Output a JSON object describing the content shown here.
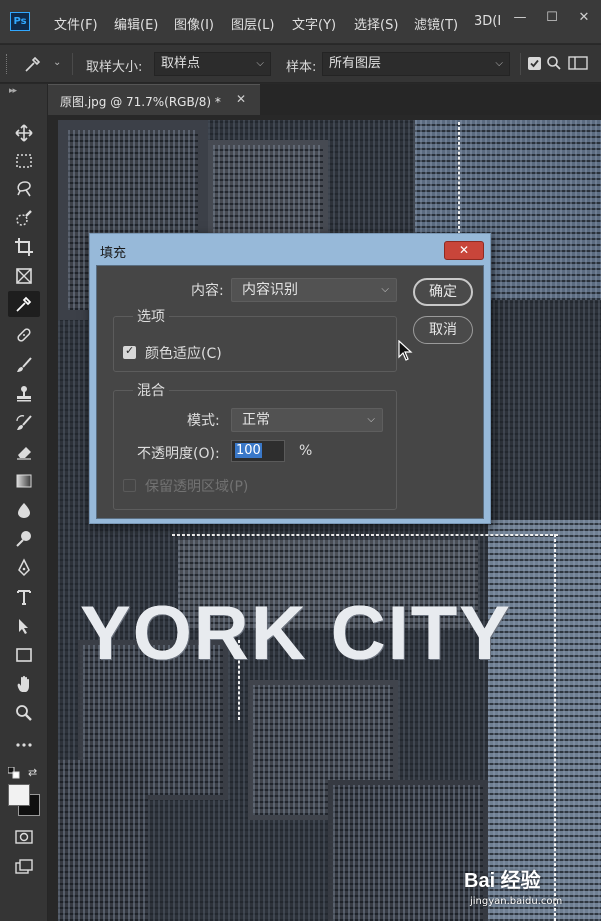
{
  "app": {
    "logo": "Ps"
  },
  "menu": [
    "文件(F)",
    "编辑(E)",
    "图像(I)",
    "图层(L)",
    "文字(Y)",
    "选择(S)",
    "滤镜(T)",
    "3D(I"
  ],
  "window_controls": {
    "minimize": "—",
    "maximize": "☐",
    "close": "✕"
  },
  "options_bar": {
    "sample_size_label": "取样大小:",
    "sample_size_value": "取样点",
    "sample_label": "样本:",
    "sample_value": "所有图层"
  },
  "tab": {
    "title": "原图.jpg @ 71.7%(RGB/8) *",
    "close": "✕"
  },
  "toolbar": {
    "collapse": "▸▸",
    "tools": [
      {
        "name": "move-tool",
        "icon": "move-icon"
      },
      {
        "name": "marquee-tool",
        "icon": "marquee-icon"
      },
      {
        "name": "lasso-tool",
        "icon": "lasso-icon"
      },
      {
        "name": "quick-select-tool",
        "icon": "quick-select-icon"
      },
      {
        "name": "crop-tool",
        "icon": "crop-icon"
      },
      {
        "name": "frame-tool",
        "icon": "frame-icon"
      },
      {
        "name": "eyedropper-tool",
        "icon": "eyedropper-icon",
        "active": true
      },
      {
        "name": "healing-tool",
        "icon": "healing-icon"
      },
      {
        "name": "brush-tool",
        "icon": "brush-icon"
      },
      {
        "name": "stamp-tool",
        "icon": "stamp-icon"
      },
      {
        "name": "history-brush-tool",
        "icon": "history-brush-icon"
      },
      {
        "name": "eraser-tool",
        "icon": "eraser-icon"
      },
      {
        "name": "gradient-tool",
        "icon": "gradient-icon"
      },
      {
        "name": "blur-tool",
        "icon": "blur-icon"
      },
      {
        "name": "dodge-tool",
        "icon": "dodge-icon"
      },
      {
        "name": "pen-tool",
        "icon": "pen-icon"
      },
      {
        "name": "type-tool",
        "icon": "type-icon"
      },
      {
        "name": "path-select-tool",
        "icon": "path-select-icon"
      },
      {
        "name": "rectangle-tool",
        "icon": "rectangle-icon"
      },
      {
        "name": "hand-tool",
        "icon": "hand-icon"
      },
      {
        "name": "zoom-tool",
        "icon": "zoom-icon"
      },
      {
        "name": "more-tools",
        "icon": "ellipsis-icon"
      }
    ]
  },
  "canvas": {
    "text_overlay": "YORK CITY"
  },
  "dialog": {
    "title": "填充",
    "close": "✕",
    "content_label": "内容:",
    "content_value": "内容识别",
    "ok": "确定",
    "cancel": "取消",
    "options_group": "选项",
    "color_adapt_label": "颜色适应(C)",
    "color_adapt_checked": true,
    "blend_group": "混合",
    "mode_label": "模式:",
    "mode_value": "正常",
    "opacity_label": "不透明度(O):",
    "opacity_value": "100",
    "opacity_unit": "%",
    "preserve_transparency_label": "保留透明区域(P)",
    "preserve_transparency_checked": false
  },
  "watermark": {
    "logo": "Bai 经验",
    "url": "jingyan.baidu.com"
  },
  "colors": {
    "accent": "#31a8ff",
    "dialog_frame": "#97b9d9",
    "close_red": "#c8453a",
    "panel": "#464646"
  }
}
